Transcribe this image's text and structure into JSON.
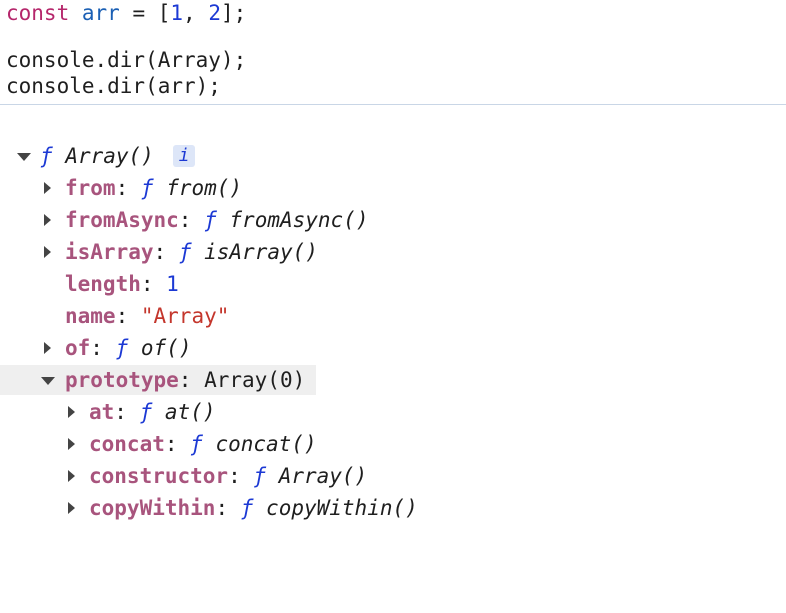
{
  "code": {
    "line1": {
      "kw": "const",
      "ident": "arr",
      "eq": " = [",
      "n1": "1",
      "comma": ", ",
      "n2": "2",
      "end": "];"
    },
    "line2": "console.dir(Array);",
    "line3": "console.dir(arr);"
  },
  "output": {
    "root": {
      "fsym": "ƒ",
      "name": "Array()",
      "badge": "i"
    },
    "props": [
      {
        "key": "from",
        "fsym": "ƒ",
        "value": "from()",
        "kind": "func",
        "expandable": true
      },
      {
        "key": "fromAsync",
        "fsym": "ƒ",
        "value": "fromAsync()",
        "kind": "func",
        "expandable": true
      },
      {
        "key": "isArray",
        "fsym": "ƒ",
        "value": "isArray()",
        "kind": "func",
        "expandable": true
      },
      {
        "key": "length",
        "value": "1",
        "kind": "number",
        "expandable": false
      },
      {
        "key": "name",
        "value": "\"Array\"",
        "kind": "string",
        "expandable": false
      },
      {
        "key": "of",
        "fsym": "ƒ",
        "value": "of()",
        "kind": "func",
        "expandable": true
      }
    ],
    "prototype": {
      "key": "prototype",
      "value": "Array(0)"
    },
    "proto_props": [
      {
        "key": "at",
        "fsym": "ƒ",
        "value": "at()"
      },
      {
        "key": "concat",
        "fsym": "ƒ",
        "value": "concat()"
      },
      {
        "key": "constructor",
        "fsym": "ƒ",
        "value": "Array()"
      },
      {
        "key": "copyWithin",
        "fsym": "ƒ",
        "value": "copyWithin()"
      }
    ]
  }
}
